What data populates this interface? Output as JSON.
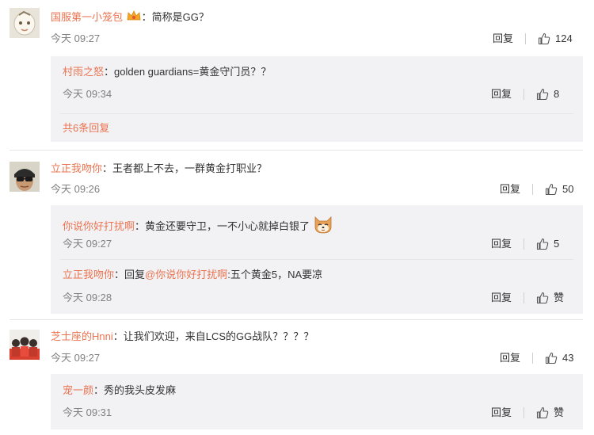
{
  "reply_label": "回复",
  "comments": [
    {
      "user": "国服第一小笼包",
      "text": "：简称是GG？",
      "time": "今天 09:27",
      "likes": "124",
      "replies": [
        {
          "user": "村雨之怒",
          "text": "：golden guardians=黄金守门员？？",
          "time": "今天 09:34",
          "likes": "8"
        }
      ],
      "more": "共6条回复"
    },
    {
      "user": "立正我吻你",
      "text": "：王者都上不去，一群黄金打职业？",
      "time": "今天 09:26",
      "likes": "50",
      "replies": [
        {
          "user": "你说你好打扰啊",
          "text": "：黄金还要守卫，一不小心就掉白银了",
          "time": "今天 09:27",
          "likes": "5"
        },
        {
          "user": "立正我吻你",
          "text_prefix": "：回复",
          "mention": "@你说你好打扰啊",
          "text": ":五个黄金5，NA要凉",
          "time": "今天 09:28",
          "likes": "赞"
        }
      ]
    },
    {
      "user": "芝士座的Hnni",
      "text": "：让我们欢迎，来自LCS的GG战队？？？？",
      "time": "今天 09:27",
      "likes": "43",
      "replies": [
        {
          "user": "宠一颜",
          "text": "：秀的我头皮发麻",
          "time": "今天 09:31",
          "likes": "赞"
        }
      ]
    }
  ],
  "icons": {
    "like": "thumbs-up-icon",
    "cat": "cat-face-emoji-icon",
    "crown": "crown-badge-icon"
  },
  "colors": {
    "username": "#eb7350",
    "time": "#808080",
    "reply_bg": "#f2f2f5",
    "divider": "#e6e6e6"
  }
}
